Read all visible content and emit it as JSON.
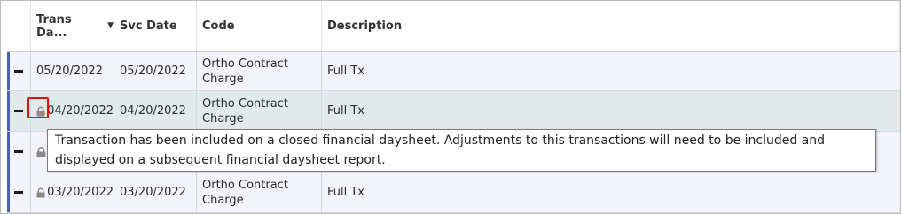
{
  "columns": {
    "trans_date": "Trans Da...",
    "svc_date": "Svc Date",
    "code": "Code",
    "description": "Description"
  },
  "sort_icon": "sort-descending-icon",
  "accent_color": "#4b5fb5",
  "highlight_color": "#e01010",
  "rows": [
    {
      "trans_date": "05/20/2022",
      "svc_date": "05/20/2022",
      "code_line1": "Ortho Contract",
      "code_line2": "Charge",
      "description": "Full Tx",
      "locked": false
    },
    {
      "trans_date": "04/20/2022",
      "svc_date": "04/20/2022",
      "code_line1": "Ortho Contract",
      "code_line2": "Charge",
      "description": "Full Tx",
      "locked": true
    },
    {
      "trans_date": "",
      "svc_date": "",
      "code_line1": "",
      "code_line2": "",
      "description": "",
      "locked": true
    },
    {
      "trans_date": "03/20/2022",
      "svc_date": "03/20/2022",
      "code_line1": "Ortho Contract",
      "code_line2": "Charge",
      "description": "Full Tx",
      "locked": true
    }
  ],
  "tooltip": {
    "text": "Transaction has been included on a closed financial daysheet. Adjustments to this transactions will need to be included and displayed on a subsequent financial daysheet report."
  }
}
